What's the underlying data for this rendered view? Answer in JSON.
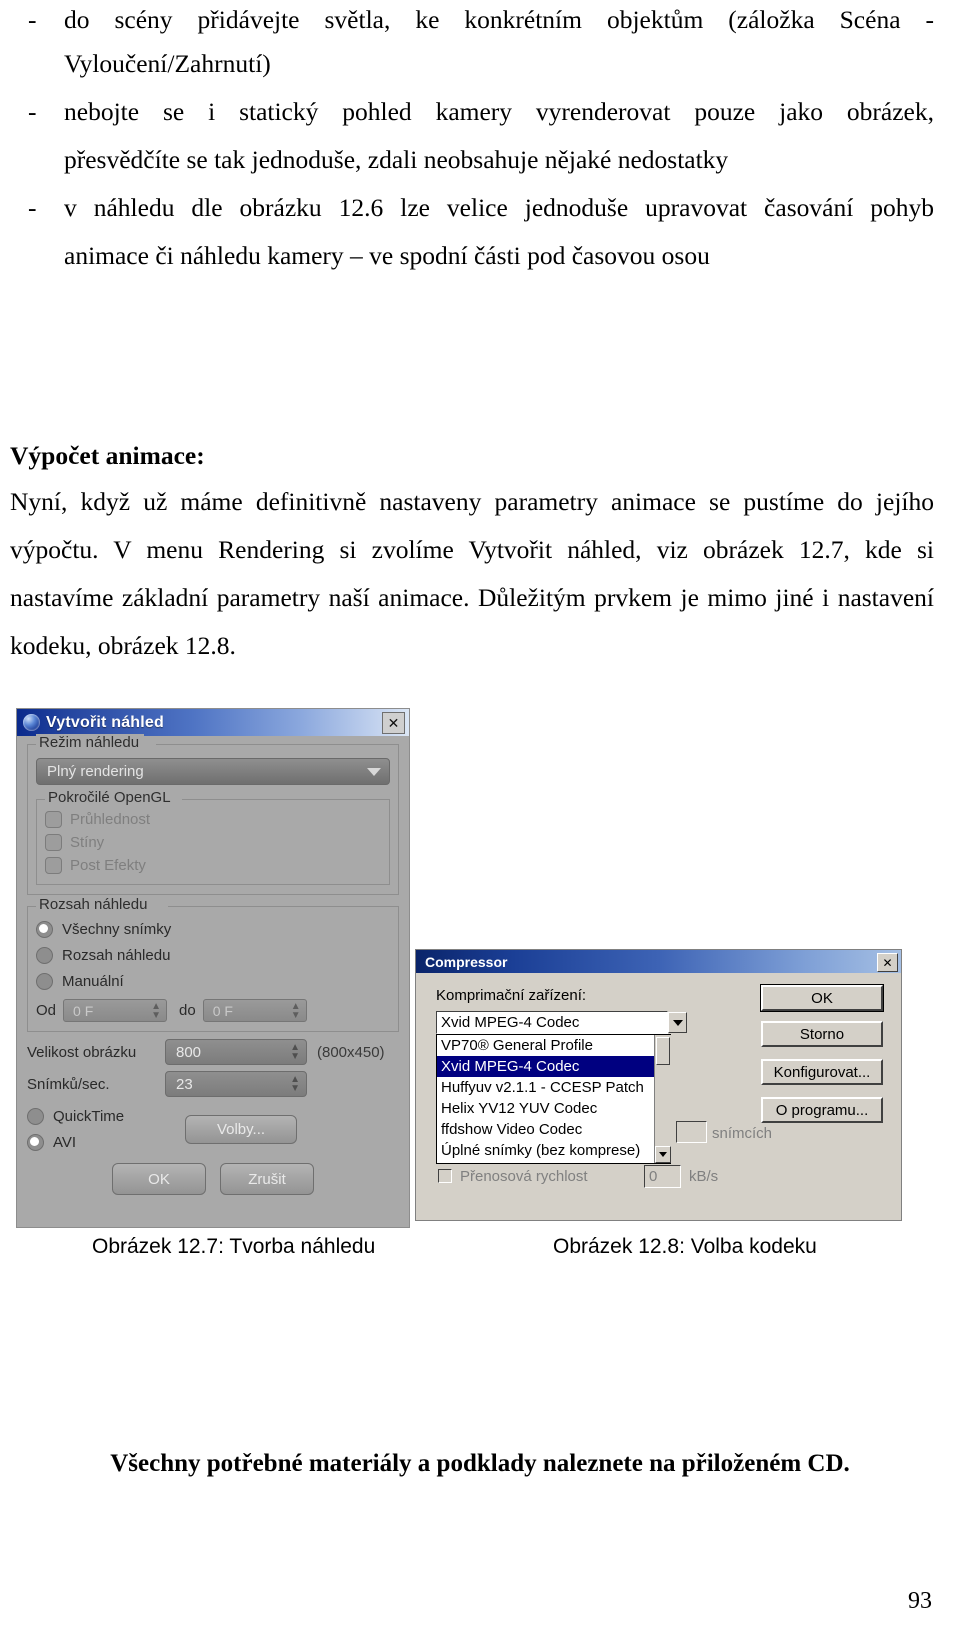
{
  "document": {
    "bullets": [
      {
        "marker": "-",
        "lines": [
          "do scény přidávejte světla, ke konkrétním objektům (záložka Scéna -",
          "Vyloučení/Zahrnutí)"
        ]
      },
      {
        "marker": "-",
        "lines": [
          "nebojte se i statický pohled kamery vyrenderovat pouze jako obrázek,",
          "přesvědčíte se tak jednoduše, zdali neobsahuje nějaké nedostatky"
        ]
      },
      {
        "marker": "-",
        "lines": [
          "v náhledu dle obrázku 12.6 lze velice jednoduše upravovat časování pohyb",
          "animace či náhledu kamery – ve spodní části pod časovou osou"
        ]
      }
    ],
    "heading": "Výpočet animace:",
    "paragraph_lines": [
      "Nyní, když už máme definitivně nastaveny parametry animace se pustíme do jejího",
      "výpočtu. V menu Rendering si zvolíme Vytvořit náhled, viz obrázek 12.7, kde si",
      "nastavíme základní parametry naší animace. Důležitým prvkem je mimo jiné i nastavení",
      "kodeku, obrázek 12.8."
    ],
    "caption_left": "Obrázek 12.7: Tvorba náhledu",
    "caption_right": "Obrázek 12.8: Volba kodeku",
    "footer": "Všechny potřebné materiály a podklady naleznete na přiloženém CD.",
    "page_number": "93"
  },
  "dialog_preview": {
    "title": "Vytvořit náhled",
    "close_label": "✕",
    "group_mode_label": "Režim náhledu",
    "mode_combo_value": "Plný rendering",
    "group_opengl_label": "Pokročilé OpenGL",
    "opengl_checkboxes": [
      {
        "label": "Průhlednost",
        "checked": false
      },
      {
        "label": "Stíny",
        "checked": false
      },
      {
        "label": "Post Efekty",
        "checked": false
      }
    ],
    "group_range_label": "Rozsah náhledu",
    "range_radios": [
      {
        "label": "Všechny snímky",
        "selected": true
      },
      {
        "label": "Rozsah náhledu",
        "selected": false
      },
      {
        "label": "Manuální",
        "selected": false
      }
    ],
    "from_label": "Od",
    "from_value": "0 F",
    "to_label": "do",
    "to_value": "0 F",
    "image_size_label": "Velikost obrázku",
    "image_size_value": "800",
    "image_size_hint": "(800x450)",
    "fps_label": "Snímků/sec.",
    "fps_value": "23",
    "format_radios": [
      {
        "label": "QuickTime",
        "selected": false
      },
      {
        "label": "AVI",
        "selected": true
      }
    ],
    "options_button": "Volby...",
    "ok_button": "OK",
    "cancel_button": "Zrušit"
  },
  "dialog_compressor": {
    "title": "Compressor",
    "close_label": "✕",
    "codec_label": "Komprimační zařízení:",
    "codec_selected": "Xvid MPEG-4 Codec",
    "codec_list": [
      {
        "label": "VP70® General Profile",
        "selected": false
      },
      {
        "label": "Xvid MPEG-4 Codec",
        "selected": true
      },
      {
        "label": "Huffyuv v2.1.1 - CCESP Patch",
        "selected": false
      },
      {
        "label": "Helix YV12 YUV Codec",
        "selected": false
      },
      {
        "label": "ffdshow Video Codec",
        "selected": false
      },
      {
        "label": "Úplné snímky (bez komprese)",
        "selected": false
      }
    ],
    "frames_label": "snímcích",
    "bitrate_checkbox_label": "Přenosová rychlost",
    "bitrate_value": "0",
    "bitrate_unit": "kB/s",
    "buttons": {
      "ok": "OK",
      "storno": "Storno",
      "configure": "Konfigurovat...",
      "about": "O programu..."
    }
  }
}
